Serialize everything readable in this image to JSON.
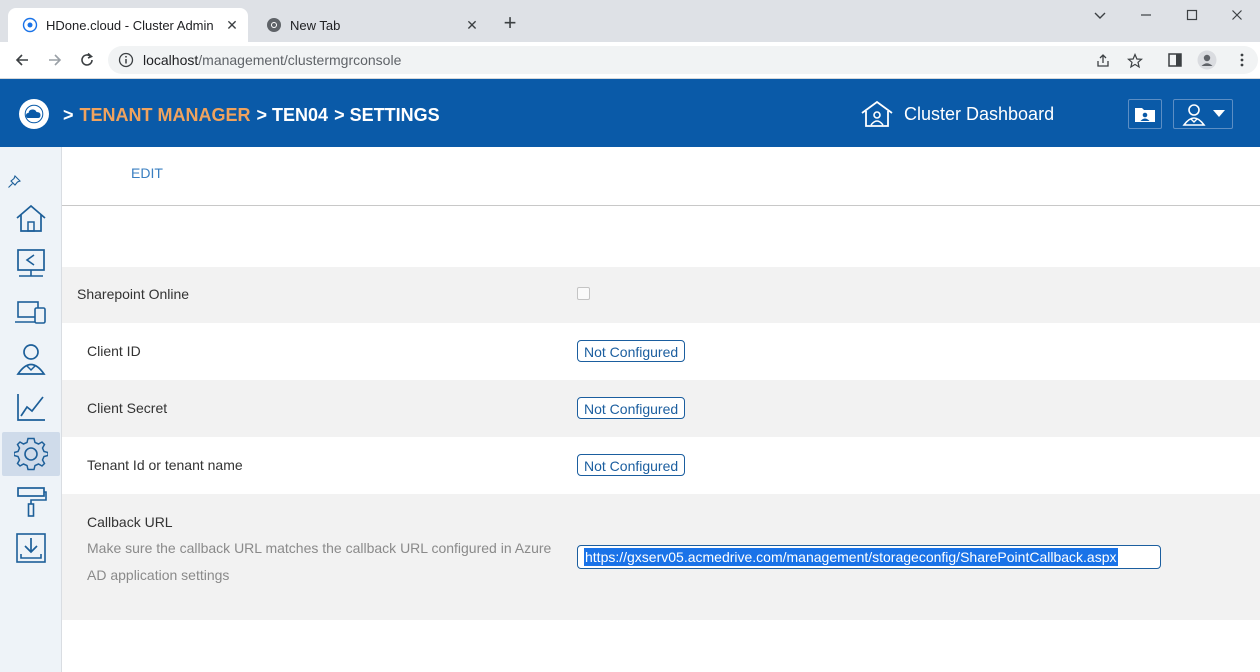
{
  "browser": {
    "tabs": [
      {
        "title": "HDone.cloud - Cluster Admin (jm",
        "active": true,
        "icon": "globe-icon"
      },
      {
        "title": "New Tab",
        "active": false,
        "icon": "chrome-icon"
      }
    ],
    "url_host": "localhost",
    "url_path": "/management/clustermgrconsole"
  },
  "header": {
    "breadcrumb_prefix": ">",
    "breadcrumb_link": "TENANT MANAGER",
    "breadcrumb_tenant": "> TEN04",
    "breadcrumb_page": "> SETTINGS",
    "cluster_dashboard_label": "Cluster Dashboard",
    "accent_color": "#0a5aa8",
    "link_color": "#f0a35e"
  },
  "sidebar": {
    "items": [
      {
        "icon": "home-icon"
      },
      {
        "icon": "shared-folder-icon"
      },
      {
        "icon": "devices-icon"
      },
      {
        "icon": "users-icon"
      },
      {
        "icon": "reports-icon"
      },
      {
        "icon": "settings-gear-icon",
        "selected": true
      },
      {
        "icon": "paint-roller-icon"
      },
      {
        "icon": "download-icon"
      }
    ]
  },
  "content": {
    "edit_label": "EDIT",
    "sharepoint_label": "Sharepoint Online",
    "sharepoint_checked": false,
    "client_id_label": "Client ID",
    "client_id_value": "Not Configured",
    "client_secret_label": "Client Secret",
    "client_secret_value": "Not Configured",
    "tenant_label": "Tenant Id or tenant name",
    "tenant_value": "Not Configured",
    "callback_label": "Callback URL",
    "callback_hint": "Make sure the callback URL matches the callback URL configured in Azure AD application settings",
    "callback_value": "https://gxserv05.acmedrive.com/management/storageconfig/SharePointCallback.aspx"
  }
}
